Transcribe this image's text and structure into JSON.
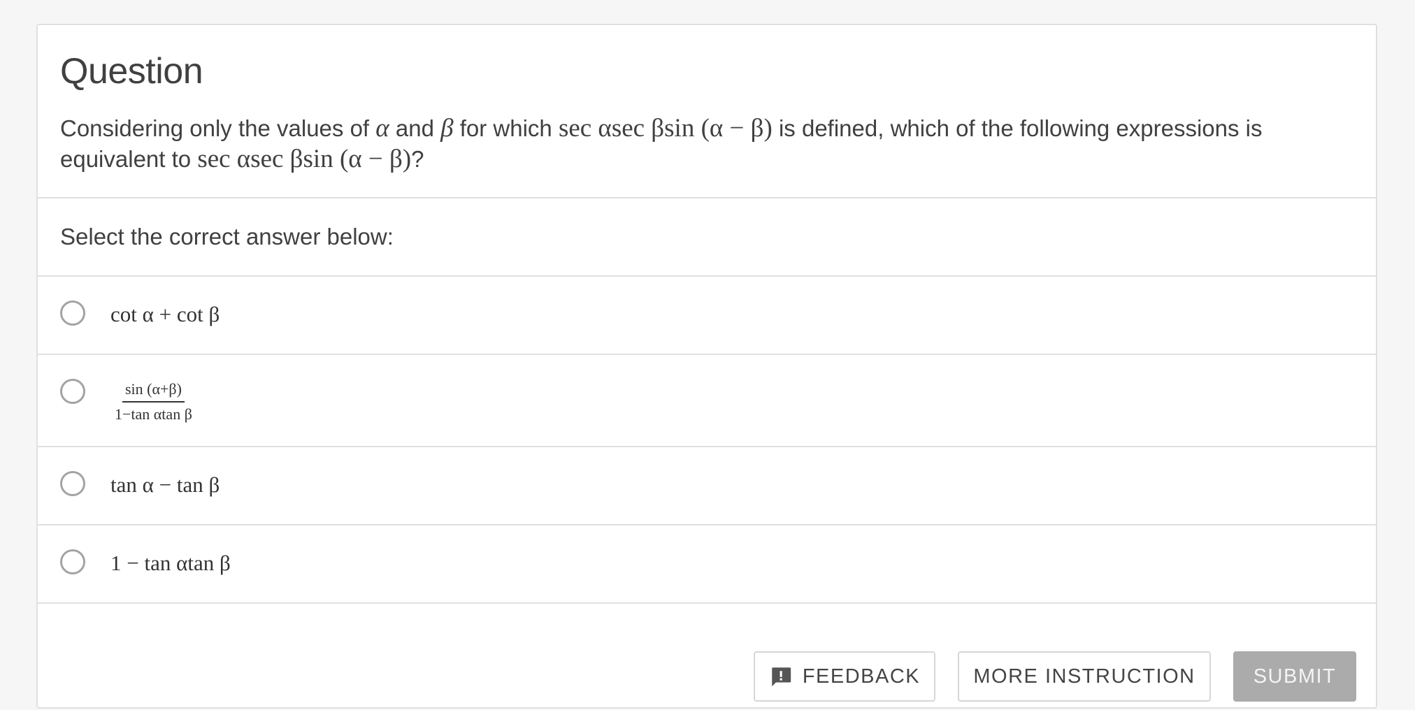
{
  "question": {
    "title": "Question",
    "text_parts": {
      "p1": "Considering only the values of ",
      "alpha": "α",
      "and": " and ",
      "beta": "β",
      "p2": " for which ",
      "expr1": "sec αsec βsin (α − β)",
      "p3": " is defined, which of the following expressions is equivalent to ",
      "expr2": "sec αsec βsin (α − β)",
      "p4": "?"
    }
  },
  "prompt": "Select the correct answer below:",
  "options": [
    {
      "label": "cot α + cot β",
      "selected": false
    },
    {
      "numerator": "sin (α+β)",
      "denominator": "1−tan αtan β",
      "selected": false
    },
    {
      "label": "tan α − tan β",
      "selected": false
    },
    {
      "label": "1 − tan αtan β",
      "selected": false
    }
  ],
  "buttons": {
    "feedback": "FEEDBACK",
    "more_instruction": "MORE INSTRUCTION",
    "submit": "SUBMIT"
  },
  "colors": {
    "submit_disabled_bg": "#ababab",
    "border": "#e0e0e0",
    "radio_border": "#a3a3a3",
    "page_bg": "#f6f6f6"
  },
  "icons": {
    "feedback": "feedback-icon",
    "radio": "radio-unchecked-icon"
  }
}
